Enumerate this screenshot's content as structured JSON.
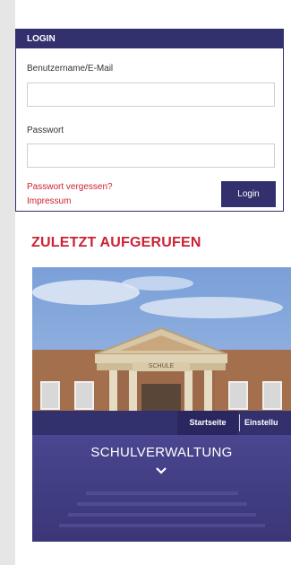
{
  "login": {
    "header": "LOGIN",
    "username_label": "Benutzername/E-Mail",
    "password_label": "Passwort",
    "forgot_password": "Passwort vergessen?",
    "imprint": "Impressum",
    "submit": "Login"
  },
  "recent": {
    "title": "ZULETZT AUFGERUFEN",
    "building_sign": "SCHULE",
    "nav": {
      "home": "Startseite",
      "settings": "Einstellu"
    },
    "card_title": "SCHULVERWALTUNG",
    "expand_icon": "chevron-down-icon"
  },
  "colors": {
    "brand": "#33306e",
    "accent": "#cc2233"
  }
}
